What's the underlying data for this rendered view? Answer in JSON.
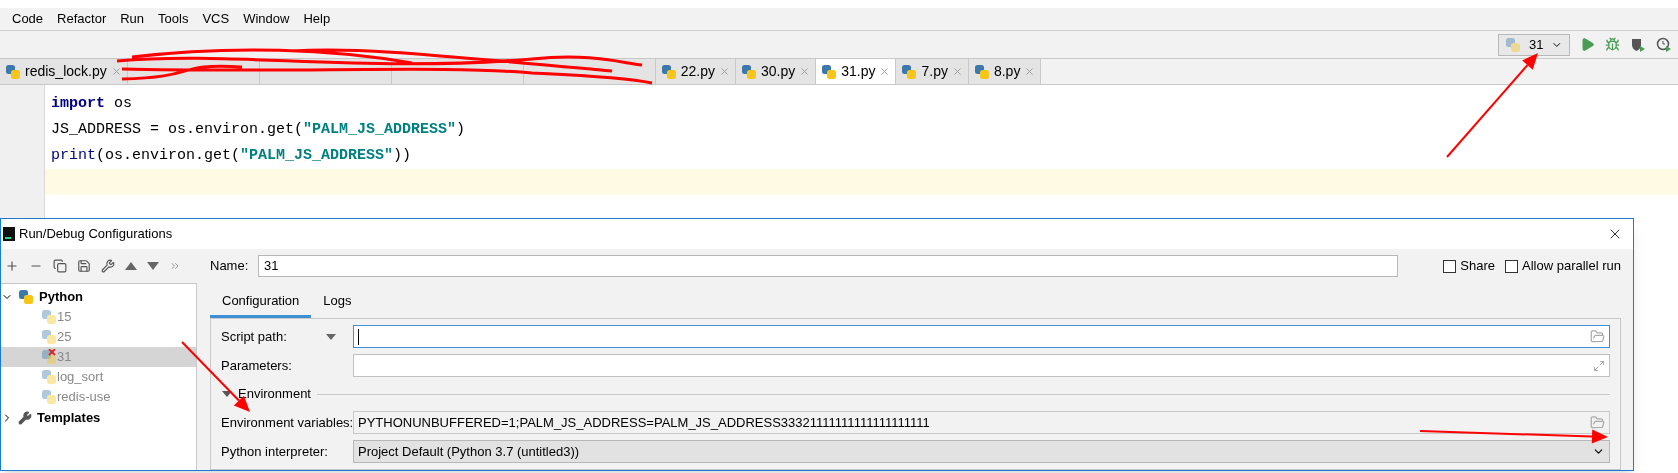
{
  "menu": [
    {
      "label": "Code"
    },
    {
      "label": "Refactor"
    },
    {
      "label": "Run"
    },
    {
      "label": "Tools"
    },
    {
      "label": "VCS"
    },
    {
      "label": "Window"
    },
    {
      "label": "Help"
    }
  ],
  "run_config": {
    "label": "31"
  },
  "editor_tabs": [
    {
      "kind": "file",
      "label": "redis_lock.py",
      "selected": false
    },
    {
      "kind": "redacted",
      "selected": false
    },
    {
      "kind": "redacted",
      "selected": false
    },
    {
      "kind": "redacted",
      "selected": false
    },
    {
      "kind": "redacted",
      "selected": false
    },
    {
      "kind": "file",
      "label": "22.py",
      "selected": false
    },
    {
      "kind": "file",
      "label": "30.py",
      "selected": false
    },
    {
      "kind": "file",
      "label": "31.py",
      "selected": true
    },
    {
      "kind": "file",
      "label": "7.py",
      "selected": false
    },
    {
      "kind": "file",
      "label": "8.py",
      "selected": false
    }
  ],
  "code_lines": [
    [
      {
        "kind": "keyword",
        "text": "import"
      },
      {
        "kind": "plain",
        "text": " os"
      }
    ],
    [
      {
        "kind": "plain",
        "text": "JS_ADDRESS = os.environ.get("
      },
      {
        "kind": "string",
        "text": "\"PALM_JS_ADDRESS\""
      },
      {
        "kind": "plain",
        "text": ")"
      }
    ],
    [
      {
        "kind": "builtin",
        "text": "print"
      },
      {
        "kind": "plain",
        "text": "(os.environ.get("
      },
      {
        "kind": "string",
        "text": "\"PALM_JS_ADDRESS\""
      },
      {
        "kind": "plain",
        "text": "))"
      }
    ]
  ],
  "dialog": {
    "title": "Run/Debug Configurations",
    "tree": [
      {
        "label": "Python",
        "expanded": true,
        "children": [
          {
            "label": "15",
            "selected": false,
            "error": false
          },
          {
            "label": "25",
            "selected": false,
            "error": false
          },
          {
            "label": "31",
            "selected": true,
            "error": true
          },
          {
            "label": "log_sort",
            "selected": false,
            "error": false
          },
          {
            "label": "redis-use",
            "selected": false,
            "error": false
          }
        ]
      },
      {
        "label": "Templates",
        "expanded": false
      }
    ],
    "name_label": "Name:",
    "name_value": "31",
    "options": [
      {
        "label": "Share",
        "checked": false
      },
      {
        "label": "Allow parallel run",
        "checked": false
      }
    ],
    "tabs": [
      {
        "label": "Configuration",
        "selected": true
      },
      {
        "label": "Logs",
        "selected": false
      }
    ],
    "script_path": {
      "label": "Script path:"
    },
    "parameters": {
      "label": "Parameters:"
    },
    "section": {
      "label": "Environment",
      "expanded": true
    },
    "env_vars": {
      "label": "Environment variables:",
      "value": "PYTHONUNBUFFERED=1;PALM_JS_ADDRESS=PALM_JS_ADDRESS33321111111111111111111"
    },
    "interpreter": {
      "label": "Python interpreter:",
      "value": "Project Default (Python 3.7 (untitled3))"
    }
  }
}
